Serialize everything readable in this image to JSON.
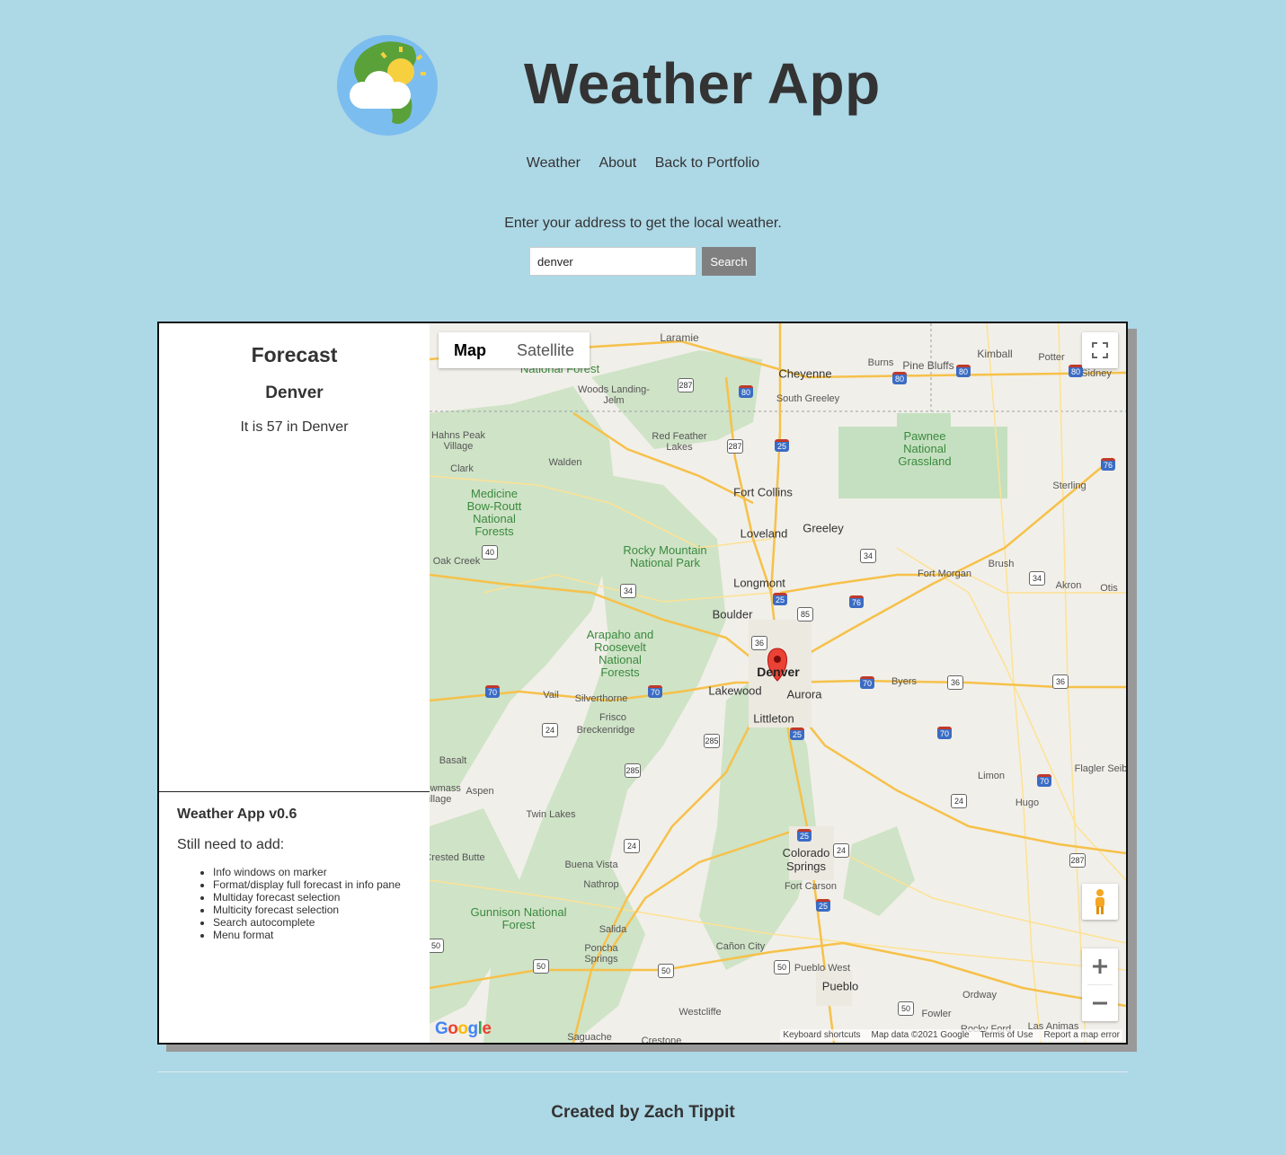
{
  "header": {
    "title": "Weather App",
    "logo": "globe-sun-cloud-icon"
  },
  "nav": {
    "items": [
      "Weather",
      "About",
      "Back to Portfolio"
    ]
  },
  "search": {
    "prompt": "Enter your address to get the local weather.",
    "value": "denver",
    "button_label": "Search"
  },
  "forecast": {
    "title": "Forecast",
    "city": "Denver",
    "text": "It is 57 in Denver"
  },
  "notes": {
    "version": "Weather App v0.6",
    "todo_heading": "Still need to add:",
    "todo_items": [
      "Info windows on marker",
      "Format/display full forecast in info pane",
      "Multiday forecast selection",
      "Multicity forecast selection",
      "Search autocomplete",
      "Menu format"
    ]
  },
  "map": {
    "type_buttons": [
      "Map",
      "Satellite"
    ],
    "selected_type": "Map",
    "attribution": [
      "Keyboard shortcuts",
      "Map data ©2021 Google",
      "Terms of Use",
      "Report a map error"
    ],
    "logo_text": "Google",
    "marker_city": "Denver",
    "places": {
      "laramie": "Laramie",
      "cheyenne": "Cheyenne",
      "south_greeley": "South Greeley",
      "burns": "Burns",
      "pine_bluffs": "Pine Bluffs",
      "kimball": "Kimball",
      "potter": "Potter",
      "sidney": "Sidney",
      "woods_landing": "Woods Landing-Jelm",
      "hahns_peak": "Hahns Peak Village",
      "red_feather": "Red Feather Lakes",
      "clark": "Clark",
      "walden": "Walden",
      "fort_collins": "Fort Collins",
      "pawnee": "Pawnee National Grassland",
      "sterling": "Sterling",
      "medicine_bow": "Medicine Bow-Routt National Forests",
      "loveland": "Loveland",
      "greeley": "Greeley",
      "rmnp": "Rocky Mountain National Park",
      "oak_creek": "Oak Creek",
      "fort_morgan": "Fort Morgan",
      "brush": "Brush",
      "longmont": "Longmont",
      "akron": "Akron",
      "otis": "Otis",
      "boulder": "Boulder",
      "arapaho": "Arapaho and Roosevelt National Forests",
      "denver": "Denver",
      "lakewood": "Lakewood",
      "aurora": "Aurora",
      "byers": "Byers",
      "vail": "Vail",
      "silverthorne": "Silverthorne",
      "frisco": "Frisco",
      "littleton": "Littleton",
      "breckenridge": "Breckenridge",
      "basalt": "Basalt",
      "limon": "Limon",
      "flagler": "Flagler Seib",
      "aspen": "Aspen",
      "snowmass": "Snowmass Village",
      "hugo": "Hugo",
      "twin_lakes": "Twin Lakes",
      "colorado_springs": "Colorado Springs",
      "crested_butte": "Crested Butte",
      "buena_vista": "Buena Vista",
      "nathrop": "Nathrop",
      "fort_carson": "Fort Carson",
      "gunnison": "Gunnison National Forest",
      "salida": "Salida",
      "canon_city": "Cañon City",
      "poncha": "Poncha Springs",
      "pueblo_west": "Pueblo West",
      "pueblo": "Pueblo",
      "ordway": "Ordway",
      "westcliffe": "Westcliffe",
      "fowler": "Fowler",
      "rocky_ford": "Rocky Ford",
      "las_animas": "Las Animas",
      "saguache": "Saguache",
      "crestone": "Crestone",
      "nf_top": "National Forest"
    },
    "shields": {
      "i80a": "80",
      "i80b": "80",
      "i80c": "80",
      "i80d": "80",
      "i25a": "25",
      "i25b": "25",
      "i25c": "25",
      "i25d": "25",
      "i25e": "25",
      "i76a": "76",
      "i76b": "76",
      "i70a": "70",
      "i70b": "70",
      "i70c": "70",
      "i70d": "70",
      "i70e": "70",
      "i70f": "70",
      "us287a": "287",
      "us287b": "287",
      "us287c": "287",
      "us34a": "34",
      "us34b": "34",
      "us34c": "34",
      "us40": "40",
      "us36a": "36",
      "us36b": "36",
      "us36c": "36",
      "us85": "85",
      "us285a": "285",
      "us285b": "285",
      "us24a": "24",
      "us24b": "24",
      "us24c": "24",
      "us24d": "24",
      "us50a": "50",
      "us50b": "50",
      "us50c": "50",
      "us50d": "50",
      "us50e": "50"
    }
  },
  "footer": {
    "credit": "Created by Zach Tippit"
  }
}
